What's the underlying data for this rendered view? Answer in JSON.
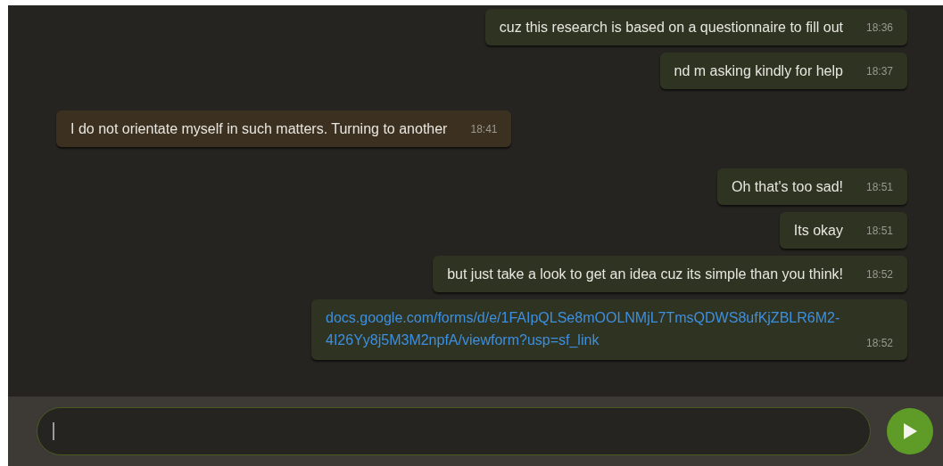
{
  "messages": [
    {
      "kind": "sent",
      "text": "cuz this research is based on a questionnaire to fill out",
      "time": "18:36"
    },
    {
      "kind": "sent",
      "text": "nd m asking kindly for help",
      "time": "18:37"
    },
    {
      "kind": "received",
      "text": "I do not orientate myself in such matters. Turning to another",
      "time": "18:41"
    },
    {
      "kind": "sent",
      "text": "Oh that's too sad!",
      "time": "18:51"
    },
    {
      "kind": "sent",
      "text": "Its okay",
      "time": "18:51"
    },
    {
      "kind": "sent",
      "text": "but just take a look to get an idea cuz its simple than you think!",
      "time": "18:52"
    },
    {
      "kind": "sent_link",
      "text": "docs.google.com/forms/d/e/1FAIpQLSe8mOOLNMjL7TmsQDWS8ufKjZBLR6M2-4I26Yy8j5M3M2npfA/viewform?usp=sf_link",
      "time": "18:52"
    }
  ]
}
